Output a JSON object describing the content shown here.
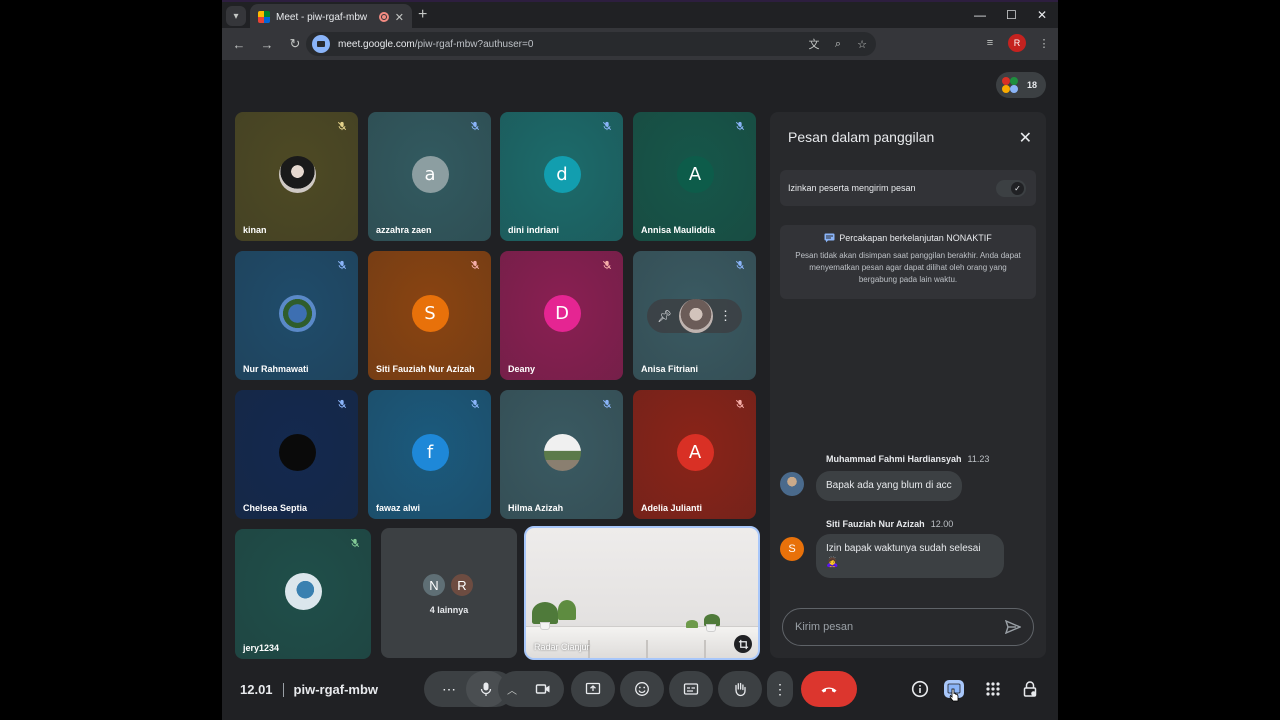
{
  "browser": {
    "tab_title": "Meet - piw-rgaf-mbw",
    "url_host": "meet.google.com",
    "url_path": "/piw-rgaf-mbw?authuser=0",
    "profile_initial": "R"
  },
  "meet": {
    "participant_count": "18",
    "tiles": [
      {
        "name": "kinan",
        "avatar": "photo",
        "bg": "#4e4a24"
      },
      {
        "name": "azzahra zaen",
        "avatar": "a",
        "bg": "#325a60",
        "avatar_color": "#8c9ea1"
      },
      {
        "name": "dini indriani",
        "avatar": "d",
        "bg": "#1c6b6b",
        "avatar_color": "#129eaf"
      },
      {
        "name": "Annisa Mauliddia",
        "avatar": "A",
        "bg": "#16574a",
        "avatar_color": "#0d5c4a"
      },
      {
        "name": "Nur Rahmawati",
        "avatar": "photo",
        "bg": "#1f4c6b"
      },
      {
        "name": "Siti Fauziah Nur Azizah",
        "avatar": "S",
        "bg": "#8a4411",
        "avatar_color": "#e8710a"
      },
      {
        "name": "Deany",
        "avatar": "D",
        "bg": "#8a1f52",
        "avatar_color": "#e52592"
      },
      {
        "name": "Anisa Fitriani",
        "avatar": "photo",
        "bg": "#3a5a62"
      },
      {
        "name": "Chelsea Septia",
        "avatar": "photo",
        "bg": "#13294f"
      },
      {
        "name": "fawaz alwi",
        "avatar": "f",
        "bg": "#1b5a7d",
        "avatar_color": "#1e88d8"
      },
      {
        "name": "Hilma Azizah",
        "avatar": "photo",
        "bg": "#3a5a62"
      },
      {
        "name": "Adelia Julianti",
        "avatar": "A",
        "bg": "#8a2318",
        "avatar_color": "#d93025"
      },
      {
        "name": "jery1234",
        "avatar": "photo",
        "bg": "#1f4f4a"
      }
    ],
    "others": {
      "initials": [
        "N",
        "R"
      ],
      "label": "4 lainnya"
    },
    "self_name": "Radar Cianjur",
    "time": "12.01",
    "meeting_code": "piw-rgaf-mbw"
  },
  "chat": {
    "title": "Pesan dalam panggilan",
    "allow_label": "Izinkan peserta mengirim pesan",
    "info_heading": "Percakapan berkelanjutan NONAKTIF",
    "info_body": "Pesan tidak akan disimpan saat panggilan berakhir. Anda dapat menyematkan pesan agar dapat dilihat oleh orang yang bergabung pada lain waktu.",
    "messages": [
      {
        "author": "Muhammad Fahmi Hardiansyah",
        "time": "11.23",
        "text": "Bapak ada yang blum di acc"
      },
      {
        "author": "Siti Fauziah Nur Azizah",
        "time": "12.00",
        "text": "Izin bapak waktunya sudah selesai",
        "emoji": "🙇‍♀️"
      }
    ],
    "compose_placeholder": "Kirim pesan"
  },
  "colors": {
    "accent": "#a8c7fa",
    "end_call": "#dc362e",
    "panel": "#28292c"
  }
}
